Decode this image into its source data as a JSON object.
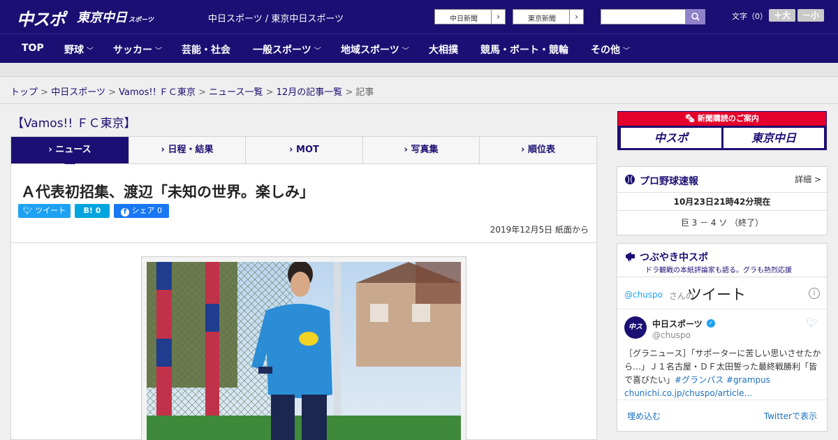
{
  "header": {
    "logo_chuspo": "中スポ",
    "logo_tokyo": "東京中日",
    "logo_tokyo_small": "スポーツ",
    "site_title": "中日スポーツ / 東京中日スポーツ",
    "paper_links": [
      "中日新聞",
      "東京新聞"
    ],
    "font_label": "文字（0）",
    "font_larger": "＋大",
    "font_smaller": "－小"
  },
  "nav": {
    "items": [
      "TOP",
      "野球",
      "サッカー",
      "芸能・社会",
      "一般スポーツ",
      "地域スポーツ",
      "大相撲",
      "競馬・ボート・競輪",
      "その他"
    ]
  },
  "breadcrumb": {
    "links": [
      "トップ",
      "中日スポーツ",
      "Vamos!! ＦＣ東京",
      "ニュース一覧",
      "12月の記事一覧"
    ],
    "current": "記事",
    "separator": ">"
  },
  "category": "【Vamos!! ＦＣ東京】",
  "tabs": [
    "ニュース",
    "日程・結果",
    "MOT",
    "写真集",
    "順位表"
  ],
  "article": {
    "headline": "Ａ代表初招集、渡辺「未知の世界。楽しみ」",
    "tweet_label": "ツイート",
    "hatena_label": "B!",
    "hatena_count": "0",
    "facebook_label": "シェア",
    "facebook_count": "0",
    "dateline": "2019年12月5日 紙面から"
  },
  "sidebar": {
    "ad_title": "新聞購読のご案内",
    "ad_buttons": [
      "中スポ",
      "東京中日"
    ],
    "score": {
      "title": "プロ野球速報",
      "detail": "詳細 >",
      "time": "10月23日21時42分現在",
      "result": "巨 3 － 4 ソ （終了）"
    },
    "tweets": {
      "title": "つぶやき中スポ",
      "subtitle": "ドラ観戦の本紙評論家も語る。グラも熱烈応援",
      "handle": "@chuspo",
      "san": "さんの",
      "tweet_word": "ツイート",
      "account_name": "中日スポーツ",
      "account_handle": "@chuspo",
      "text": "［グラニュース］「サポーターに苦しい思いさせたから…」Ｊ１名古屋・ＤＦ太田誓った最終戦勝利「皆で喜びたい」",
      "hashtags": "#グランパス #grampus",
      "link": "chunichi.co.jp/chuspo/article…",
      "embed": "埋め込む",
      "view": "Twitterで表示"
    }
  },
  "colors": {
    "brand": "#1c0f73",
    "accent_red": "#e4002b",
    "twitter": "#1da1f2",
    "hatena": "#00a4de",
    "facebook": "#1877f2"
  }
}
